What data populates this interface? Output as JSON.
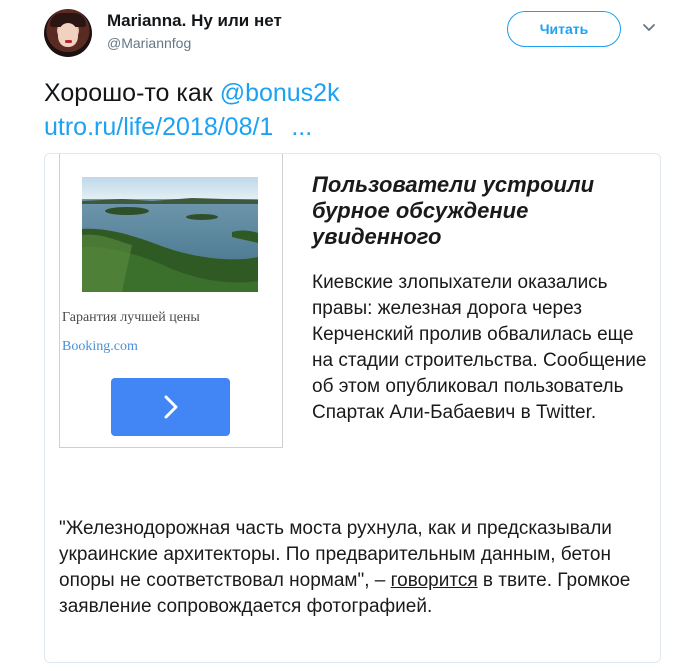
{
  "author": {
    "display_name": "Marianna. Ну или нет",
    "handle": "@Mariannfog"
  },
  "actions": {
    "follow_label": "Читать"
  },
  "tweet": {
    "text_prefix": "Хорошо-то как ",
    "mention": "@bonus2k",
    "url": "utro.ru/life/2018/08/1",
    "url_ellipsis": "..."
  },
  "card": {
    "ad": {
      "caption": "Гарантия лучшей цены",
      "source": "Booking.com"
    },
    "headline": "Пользователи устроили бурное обсуждение увиденного",
    "lead": "Киевские злопыхатели оказались правы: железная дорога через Керченский пролив обвалилась еще на стадии строительства. Сообщение об этом опубликовал пользователь Спартак Али-Бабаевич в Twitter.",
    "body_before": "\"Железнодорожная часть моста рухнула, как и предсказывали украинские архитекторы. По предварительным данным, бетон опоры не соответствовал нормам\", – ",
    "body_link": "говорится",
    "body_after": " в твите. Громкое заявление сопровождается фотографией."
  },
  "colors": {
    "accent": "#1da1f2",
    "ad_button": "#4285f4",
    "ad_source": "#4a90d9"
  },
  "icons": {
    "caret": "chevron-down-icon",
    "ad_arrow": "chevron-right-icon"
  }
}
